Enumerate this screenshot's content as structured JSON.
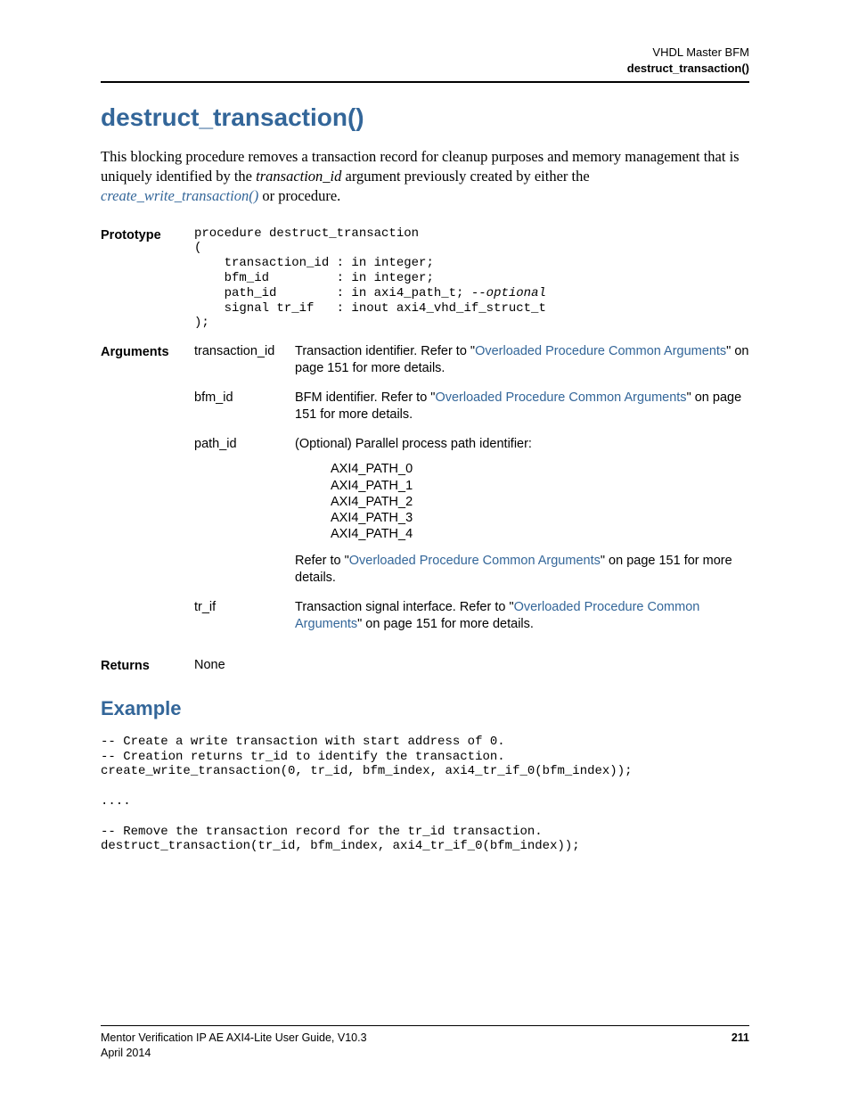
{
  "header": {
    "line1": "VHDL Master BFM",
    "line2": "destruct_transaction()"
  },
  "title": "destruct_transaction()",
  "intro": {
    "part1": "This blocking procedure removes a transaction record for cleanup purposes and memory management that is uniquely identified by the ",
    "ital": "transaction_id",
    "part2": " argument previously created by either the ",
    "link": "create_write_transaction()",
    "part3": " or  procedure."
  },
  "prototype": {
    "label": "Prototype",
    "code": "procedure destruct_transaction\n(\n    transaction_id : in integer;\n    bfm_id         : in integer;\n    path_id        : in axi4_path_t; ",
    "comment": "--optional",
    "code2": "\n    signal tr_if   : inout axi4_vhd_if_struct_t\n);"
  },
  "arguments": {
    "label": "Arguments",
    "items": [
      {
        "name": "transaction_id",
        "pre": "Transaction identifier. Refer to \"",
        "link": "Overloaded Procedure Common Arguments",
        "post": "\" on page 151 for more details."
      },
      {
        "name": "bfm_id",
        "pre": "BFM identifier. Refer to \"",
        "link": "Overloaded Procedure Common Arguments",
        "post": "\" on page 151 for more details."
      },
      {
        "name": "path_id",
        "optline": "(Optional) Parallel process path identifier:",
        "paths": "AXI4_PATH_0\nAXI4_PATH_1\nAXI4_PATH_2\nAXI4_PATH_3\nAXI4_PATH_4",
        "pre": "Refer to \"",
        "link": "Overloaded Procedure Common Arguments",
        "post": "\" on page 151 for more details."
      },
      {
        "name": "tr_if",
        "pre": "Transaction signal interface. Refer to \"",
        "link": "Overloaded Procedure Common Arguments",
        "post": "\" on page 151 for more details."
      }
    ]
  },
  "returns": {
    "label": "Returns",
    "value": "None"
  },
  "example": {
    "label": "Example",
    "code": "-- Create a write transaction with start address of 0.\n-- Creation returns tr_id to identify the transaction.\ncreate_write_transaction(0, tr_id, bfm_index, axi4_tr_if_0(bfm_index));\n\n....\n\n-- Remove the transaction record for the tr_id transaction.\ndestruct_transaction(tr_id, bfm_index, axi4_tr_if_0(bfm_index));"
  },
  "footer": {
    "left1": "Mentor Verification IP AE AXI4-Lite User Guide, V10.3",
    "left2": "April 2014",
    "page": "211"
  }
}
